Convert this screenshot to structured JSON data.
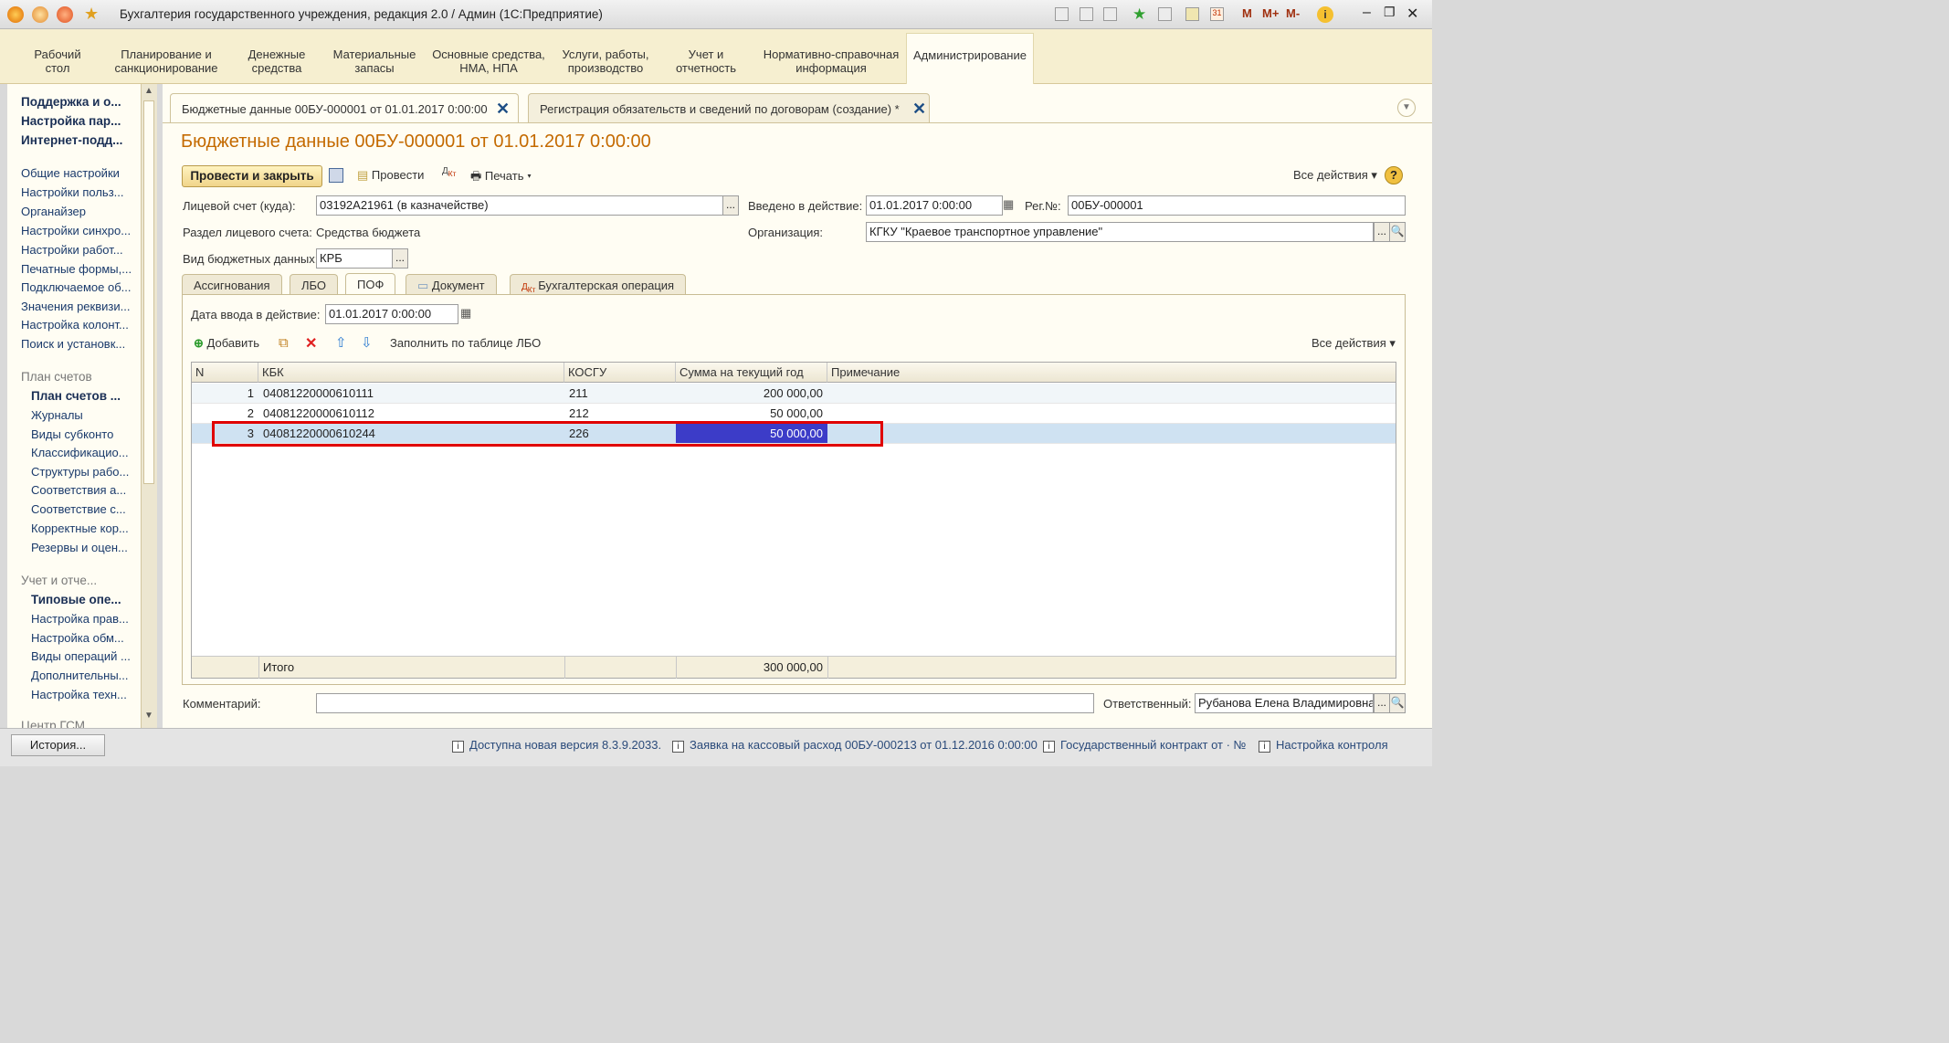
{
  "window": {
    "title": "Бухгалтерия государственного учреждения, редакция 2.0 / Админ (1С:Предприятие)",
    "m_labels": [
      "M",
      "M+",
      "M-"
    ]
  },
  "menu": {
    "items": [
      {
        "line1": "Рабочий",
        "line2": "стол"
      },
      {
        "line1": "Планирование и",
        "line2": "санкционирование"
      },
      {
        "line1": "Денежные",
        "line2": "средства"
      },
      {
        "line1": "Материальные",
        "line2": "запасы"
      },
      {
        "line1": "Основные средства,",
        "line2": "НМА, НПА"
      },
      {
        "line1": "Услуги, работы,",
        "line2": "производство"
      },
      {
        "line1": "Учет и",
        "line2": "отчетность"
      },
      {
        "line1": "Нормативно-справочная",
        "line2": "информация"
      },
      {
        "line1": "Администрирование",
        "line2": ""
      }
    ]
  },
  "sidebar": {
    "items": [
      "Поддержка и о...",
      "Настройка пар...",
      "Интернет-подд...",
      "Общие настройки",
      "Настройки польз...",
      "Органайзер",
      "Настройки синхро...",
      "Настройки работ...",
      "Печатные формы,...",
      "Подключаемое об...",
      "Значения реквизи...",
      "Настройка колонт...",
      "Поиск и установк...",
      "План счетов",
      "План счетов ...",
      "Журналы",
      "Виды субконто",
      "Классификацио...",
      "Структуры рабо...",
      "Соответствия а...",
      "Соответствие с...",
      "Корректные кор...",
      "Резервы и оцен...",
      "Учет и отче...",
      "Типовые опе...",
      "Настройка прав...",
      "Настройка обм...",
      "Виды операций ...",
      "Дополнительны...",
      "Настройка техн...",
      "Центр ГСМ"
    ]
  },
  "tabs": [
    {
      "label": "Бюджетные данные 00БУ-000001 от 01.01.2017 0:00:00"
    },
    {
      "label": "Регистрация обязательств и сведений по договорам (создание) *"
    }
  ],
  "doc": {
    "title": "Бюджетные данные 00БУ-000001 от 01.01.2017 0:00:00",
    "toolbar": {
      "post_close": "Провести и закрыть",
      "post": "Провести",
      "print": "Печать",
      "all_actions": "Все действия",
      "help": "?"
    },
    "account_label": "Лицевой счет (куда):",
    "account_value": "03192A21961 (в казначействе)",
    "effective_label": "Введено в действие:",
    "effective_value": "01.01.2017  0:00:00",
    "reg_label": "Рег.№:",
    "reg_value": "00БУ-000001",
    "section_label": "Раздел лицевого счета:",
    "section_value": "Средства бюджета",
    "org_label": "Организация:",
    "org_value": "КГКУ \"Краевое транспортное управление\"",
    "kind_label": "Вид бюджетных данных:",
    "kind_value": "КРБ",
    "dots": "..."
  },
  "form_tabs": [
    "Ассигнования",
    "ЛБО",
    "ПОФ",
    "Документ",
    "Бухгалтерская операция"
  ],
  "pof": {
    "date_label": "Дата ввода в действие:",
    "date_value": "01.01.2017  0:00:00",
    "add": "Добавить",
    "fill": "Заполнить по таблице ЛБО",
    "all_actions": "Все действия",
    "columns": [
      "N",
      "КБК",
      "КОСГУ",
      "Сумма на текущий год",
      "Примечание"
    ],
    "rows": [
      {
        "n": "1",
        "kbk": "04081220000610111",
        "kosgu": "211",
        "sum": "200 000,00",
        "note": ""
      },
      {
        "n": "2",
        "kbk": "04081220000610112",
        "kosgu": "212",
        "sum": "50 000,00",
        "note": ""
      },
      {
        "n": "3",
        "kbk": "04081220000610244",
        "kosgu": "226",
        "sum": "50 000,00",
        "note": ""
      }
    ],
    "total_label": "Итого",
    "total_sum": "300 000,00"
  },
  "bottom": {
    "comment_label": "Комментарий:",
    "comment_value": "",
    "responsible_label": "Ответственный:",
    "responsible_value": "Рубанова Елена Владимировна"
  },
  "status": {
    "history": "История...",
    "items": [
      "Доступна новая версия 8.3.9.2033.",
      "Заявка на кассовый расход 00БУ-000213 от 01.12.2016 0:00:00",
      "Государственный контракт от · №",
      "Настройка контроля"
    ]
  },
  "colors": {
    "accent": "#c46a00",
    "menu_bg": "#f6efd0",
    "selection": "#3c3cc8",
    "highlight_box": "#e00000"
  }
}
